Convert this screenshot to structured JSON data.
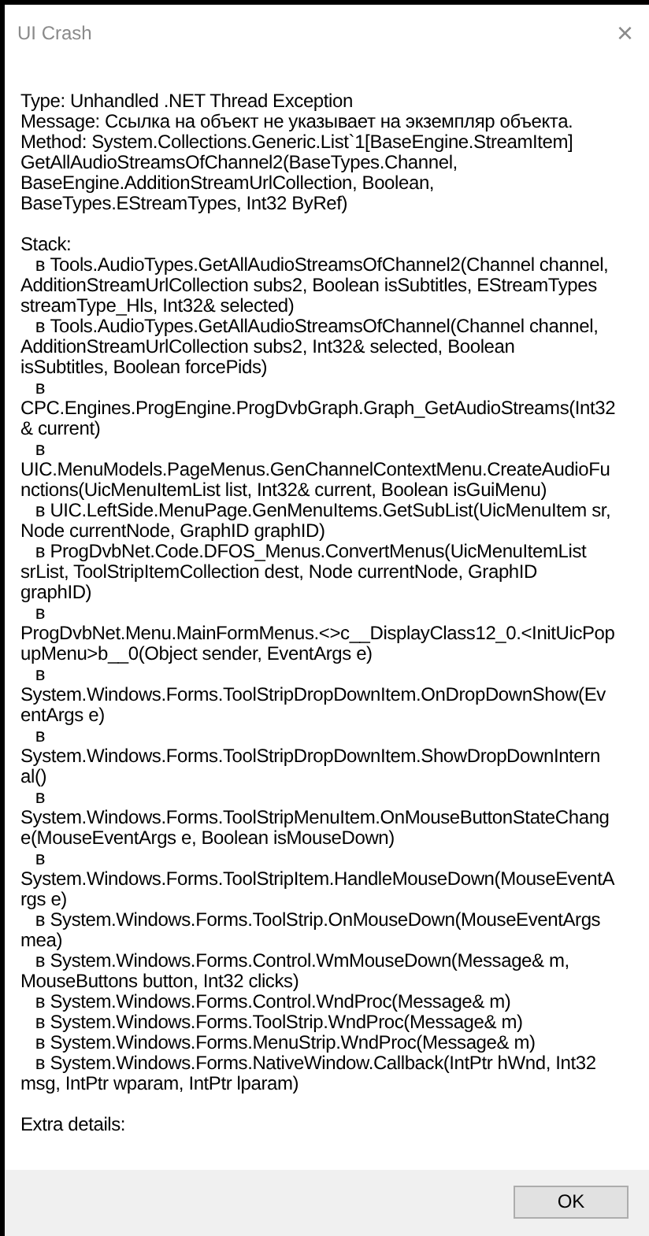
{
  "window": {
    "title": "UI Crash",
    "close": "×"
  },
  "details": {
    "blocks": [
      [
        "Type: Unhandled .NET Thread Exception",
        "Message: Ссылка на объект не указывает на экземпляр объекта.",
        "Method: System.Collections.Generic.List`1[BaseEngine.StreamItem]",
        "GetAllAudioStreamsOfChannel2(BaseTypes.Channel,",
        "BaseEngine.AdditionStreamUrlCollection, Boolean,",
        "BaseTypes.EStreamTypes, Int32 ByRef)"
      ],
      [
        "Stack:",
        "   в Tools.AudioTypes.GetAllAudioStreamsOfChannel2(Channel channel,",
        "AdditionStreamUrlCollection subs2, Boolean isSubtitles, EStreamTypes",
        "streamType_Hls, Int32& selected)",
        "   в Tools.AudioTypes.GetAllAudioStreamsOfChannel(Channel channel,",
        "AdditionStreamUrlCollection subs2, Int32& selected, Boolean",
        "isSubtitles, Boolean forcePids)",
        "   в",
        "CPC.Engines.ProgEngine.ProgDvbGraph.Graph_GetAudioStreams(Int32",
        "& current)",
        "   в",
        "UIC.MenuModels.PageMenus.GenChannelContextMenu.CreateAudioFu",
        "nctions(UicMenuItemList list, Int32& current, Boolean isGuiMenu)",
        "   в UIC.LeftSide.MenuPage.GenMenuItems.GetSubList(UicMenuItem sr,",
        "Node currentNode, GraphID graphID)",
        "   в ProgDvbNet.Code.DFOS_Menus.ConvertMenus(UicMenuItemList",
        "srList, ToolStripItemCollection dest, Node currentNode, GraphID",
        "graphID)",
        "   в",
        "ProgDvbNet.Menu.MainFormMenus.<>c__DisplayClass12_0.<InitUicPop",
        "upMenu>b__0(Object sender, EventArgs e)",
        "   в",
        "System.Windows.Forms.ToolStripDropDownItem.OnDropDownShow(Ev",
        "entArgs e)",
        "   в",
        "System.Windows.Forms.ToolStripDropDownItem.ShowDropDownIntern",
        "al()",
        "   в",
        "System.Windows.Forms.ToolStripMenuItem.OnMouseButtonStateChang",
        "e(MouseEventArgs e, Boolean isMouseDown)",
        "   в",
        "System.Windows.Forms.ToolStripItem.HandleMouseDown(MouseEventA",
        "rgs e)",
        "   в System.Windows.Forms.ToolStrip.OnMouseDown(MouseEventArgs",
        "mea)",
        "   в System.Windows.Forms.Control.WmMouseDown(Message& m,",
        "MouseButtons button, Int32 clicks)",
        "   в System.Windows.Forms.Control.WndProc(Message& m)",
        "   в System.Windows.Forms.ToolStrip.WndProc(Message& m)",
        "   в System.Windows.Forms.MenuStrip.WndProc(Message& m)",
        "   в System.Windows.Forms.NativeWindow.Callback(IntPtr hWnd, Int32",
        "msg, IntPtr wparam, IntPtr lparam)"
      ],
      [
        "Extra details:"
      ]
    ]
  },
  "buttons": [
    "OK"
  ]
}
